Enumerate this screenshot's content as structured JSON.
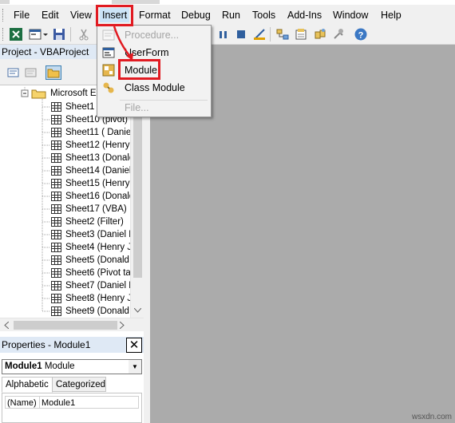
{
  "menubar": {
    "items": [
      "File",
      "Edit",
      "View",
      "Insert",
      "Format",
      "Debug",
      "Run",
      "Tools",
      "Add-Ins",
      "Window",
      "Help"
    ]
  },
  "insert_menu": {
    "items": [
      {
        "label": "Procedure...",
        "enabled": false,
        "icon": "procedure-icon"
      },
      {
        "label": "UserForm",
        "enabled": true,
        "icon": "userform-icon"
      },
      {
        "label": "Module",
        "enabled": true,
        "icon": "module-icon"
      },
      {
        "label": "Class Module",
        "enabled": true,
        "icon": "class-module-icon"
      },
      {
        "label": "File...",
        "enabled": false,
        "icon": ""
      }
    ]
  },
  "project": {
    "title": "Project - VBAProject",
    "root_label": "Microsoft Ex",
    "sheets": [
      "Sheet1 (",
      "Sheet10 (pivot)",
      "Sheet11 ( Daniel",
      "Sheet12 (Henry",
      "Sheet13 (Donald",
      "Sheet14 (Daniel",
      "Sheet15 (Henry",
      "Sheet16 (Donald",
      "Sheet17 (VBA)",
      "Sheet2 (Filter)",
      "Sheet3 (Daniel D",
      "Sheet4 (Henry J",
      "Sheet5 (Donald I",
      "Sheet6 (Pivot ta",
      "Sheet7 (Daniel D",
      "Sheet8 (Henry J",
      "Sheet9 (Donald I"
    ]
  },
  "properties": {
    "title": "Properties - Module1",
    "close_label": "✕",
    "object_name": "Module1",
    "object_type": "Module",
    "tabs": [
      "Alphabetic",
      "Categorized"
    ],
    "row_key": "(Name)",
    "row_value": "Module1"
  },
  "watermark": "wsxdn.com",
  "colors": {
    "highlight": "#e11b22",
    "workspace": "#ababab",
    "menu_open": "#cce4f7"
  }
}
